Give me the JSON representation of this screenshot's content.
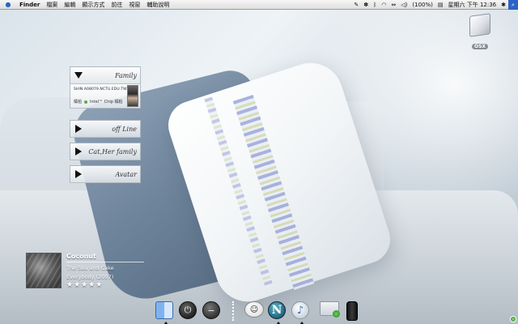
{
  "menubar": {
    "apple_icon": "apple-icon",
    "items": [
      "Finder",
      "檔案",
      "編輯",
      "顯示方式",
      "前往",
      "視窗",
      "輔助說明"
    ],
    "status_icons": [
      "script-icon",
      "paw-icon",
      "bluetooth-icon",
      "wifi-icon",
      "sync-icon",
      "volume-icon"
    ],
    "battery": "(100%)",
    "clock": "星期六 下午 12:36",
    "flag_icon": "us-flag-icon",
    "spotlight_icon": "spotlight-icon"
  },
  "desktop": {
    "icon_label": "OSX"
  },
  "contacts": {
    "groups": [
      {
        "name": "Family",
        "expanded": true,
        "contact": {
          "email": "SHIN.A08079.NCTU.EDU.TW",
          "name": "橘柏",
          "status": "Intel™ Chip 橘柏"
        }
      },
      {
        "name": "off Line",
        "expanded": false
      },
      {
        "name": "Cat,Her family",
        "expanded": false
      },
      {
        "name": "Avatar",
        "expanded": false
      }
    ]
  },
  "nowplaying": {
    "title": "Coconut",
    "artist": "The Sea and Cake",
    "album": "Everybody (2007)",
    "stars": "★★★★★",
    "rating": 5
  },
  "dock": {
    "items": [
      "finder-icon",
      "power-icon",
      "minus-icon",
      "chat-icon",
      "n-icon",
      "itunes-icon",
      "prefs-icon",
      "cup-icon"
    ],
    "power_glyph": "⏻",
    "minus_glyph": "−",
    "chat_glyph": "☺",
    "n_glyph": "N",
    "itunes_glyph": "♪"
  }
}
